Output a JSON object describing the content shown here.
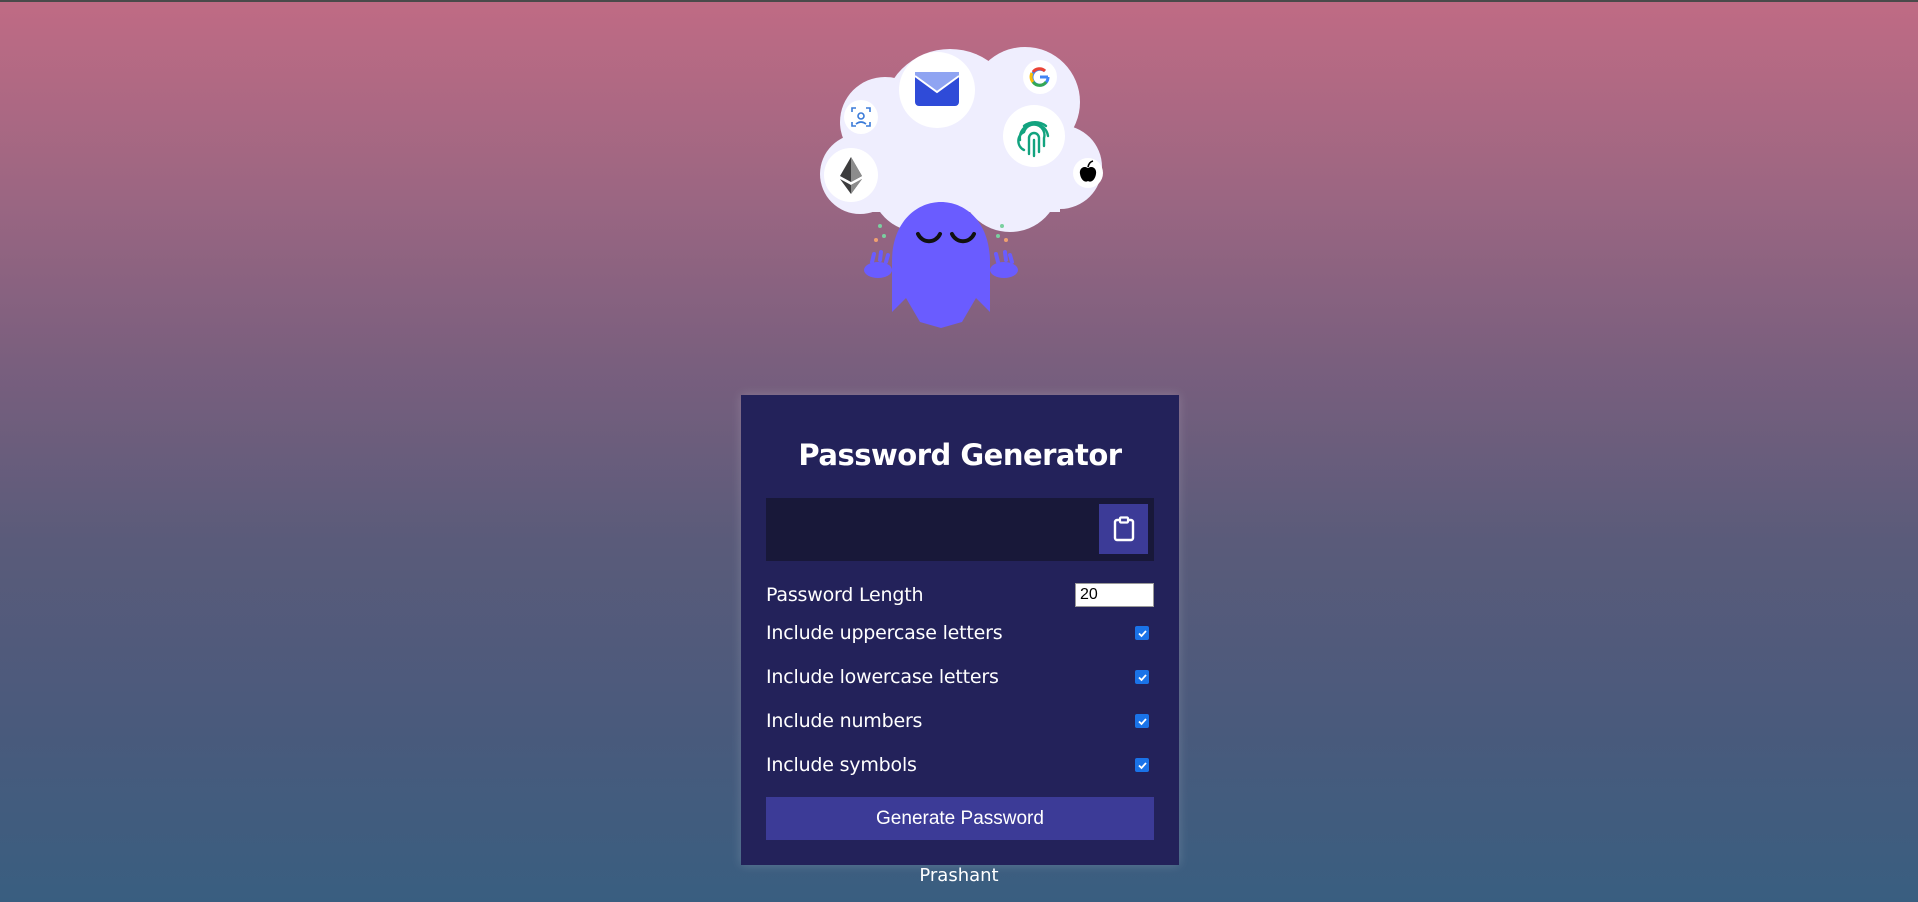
{
  "app": {
    "title": "Password Generator",
    "author": "Prashant"
  },
  "hero": {
    "icons": [
      "envelope-icon",
      "google-icon",
      "face-id-icon",
      "fingerprint-icon",
      "ethereum-icon",
      "apple-icon"
    ]
  },
  "result": {
    "value": "",
    "copy_icon": "clipboard-icon"
  },
  "settings": {
    "length_label": "Password Length",
    "length_value": "20",
    "uppercase_label": "Include uppercase letters",
    "uppercase_checked": true,
    "lowercase_label": "Include lowercase letters",
    "lowercase_checked": true,
    "numbers_label": "Include numbers",
    "numbers_checked": true,
    "symbols_label": "Include symbols",
    "symbols_checked": true
  },
  "actions": {
    "generate_label": "Generate Password"
  },
  "colors": {
    "card_bg": "#23225a",
    "result_bg": "#181839",
    "button_bg": "#3c3b97",
    "checkbox_blue": "#1a73e8",
    "ghost_purple": "#6a5cff"
  }
}
